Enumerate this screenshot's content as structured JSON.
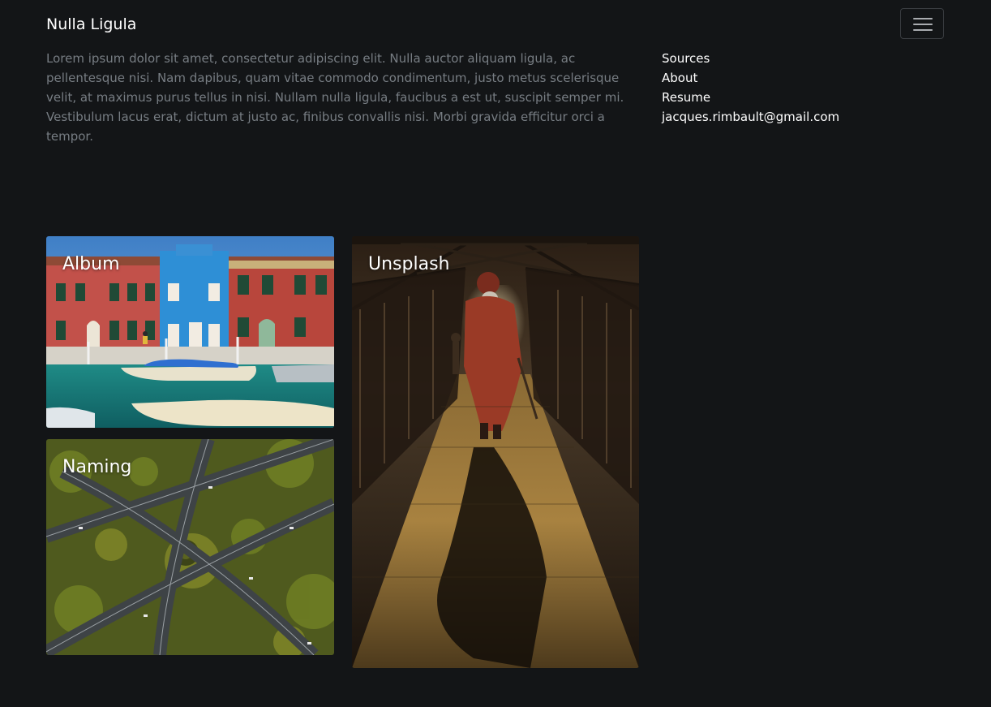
{
  "navbar": {
    "brand": "Nulla Ligula",
    "toggle_icon": "hamburger-menu-icon"
  },
  "header": {
    "intro": "Lorem ipsum dolor sit amet, consectetur adipiscing elit. Nulla auctor aliquam ligula, ac pellentesque nisi. Nam dapibus, quam vitae commodo condimentum, justo metus scelerisque velit, at maximus purus tellus in nisi. Nullam nulla ligula, faucibus a est ut, suscipit semper mi. Vestibulum lacus erat, dictum at justo ac, finibus convallis nisi. Morbi gravida efficitur orci a tempor.",
    "links": [
      {
        "label": "Sources"
      },
      {
        "label": "About"
      },
      {
        "label": "Resume"
      },
      {
        "label": "jacques.rimbault@gmail.com"
      }
    ]
  },
  "gallery": {
    "cards": [
      {
        "title": "Album",
        "image": "colorful-canal-houses-with-boats"
      },
      {
        "title": "Unsplash",
        "image": "person-walking-on-bridge-at-sunset"
      },
      {
        "title": "Naming",
        "image": "aerial-highway-interchange-over-forest"
      }
    ]
  },
  "colors": {
    "background": "#131517",
    "text_primary": "#ffffff",
    "text_muted": "#777d83",
    "toggler_border": "#3a3d41"
  }
}
